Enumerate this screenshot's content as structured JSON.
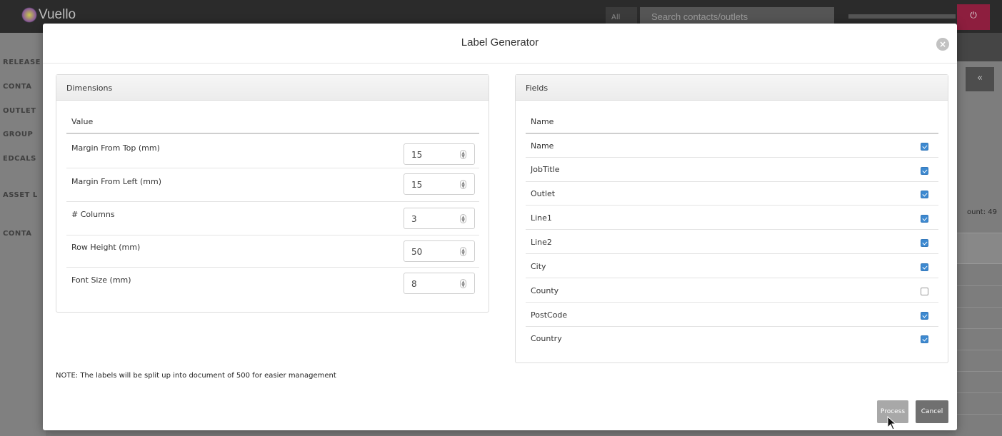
{
  "app": {
    "logo": "Vuello",
    "search_scope": "All",
    "search_placeholder": "Search contacts/outlets",
    "power_icon": "⏻",
    "nav": [
      "RELEASE",
      "CONTA",
      "OUTLET",
      "GROUP",
      "EDCALS",
      "ASSET L",
      "CONTA"
    ],
    "count_label": "ount: 49",
    "collapse_icon": "«"
  },
  "modal": {
    "title": "Label Generator",
    "close_icon": "×",
    "dimensions": {
      "heading": "Dimensions",
      "column": "Value",
      "rows": [
        {
          "label": "Margin From Top (mm)",
          "value": "15"
        },
        {
          "label": "Margin From Left (mm)",
          "value": "15"
        },
        {
          "label": "# Columns",
          "value": "3"
        },
        {
          "label": "Row Height (mm)",
          "value": "50"
        },
        {
          "label": "Font Size (mm)",
          "value": "8"
        }
      ]
    },
    "fields": {
      "heading": "Fields",
      "column": "Name",
      "rows": [
        {
          "label": "Name",
          "checked": true
        },
        {
          "label": "JobTitle",
          "checked": true
        },
        {
          "label": "Outlet",
          "checked": true
        },
        {
          "label": "Line1",
          "checked": true
        },
        {
          "label": "Line2",
          "checked": true
        },
        {
          "label": "City",
          "checked": true
        },
        {
          "label": "County",
          "checked": false
        },
        {
          "label": "PostCode",
          "checked": true
        },
        {
          "label": "Country",
          "checked": true
        }
      ]
    },
    "note": "NOTE: The labels will be split up into document of 500 for easier management",
    "buttons": {
      "process": "Process",
      "cancel": "Cancel"
    }
  },
  "colors": {
    "accent": "#3d89d0",
    "power": "#8d1e3e"
  }
}
